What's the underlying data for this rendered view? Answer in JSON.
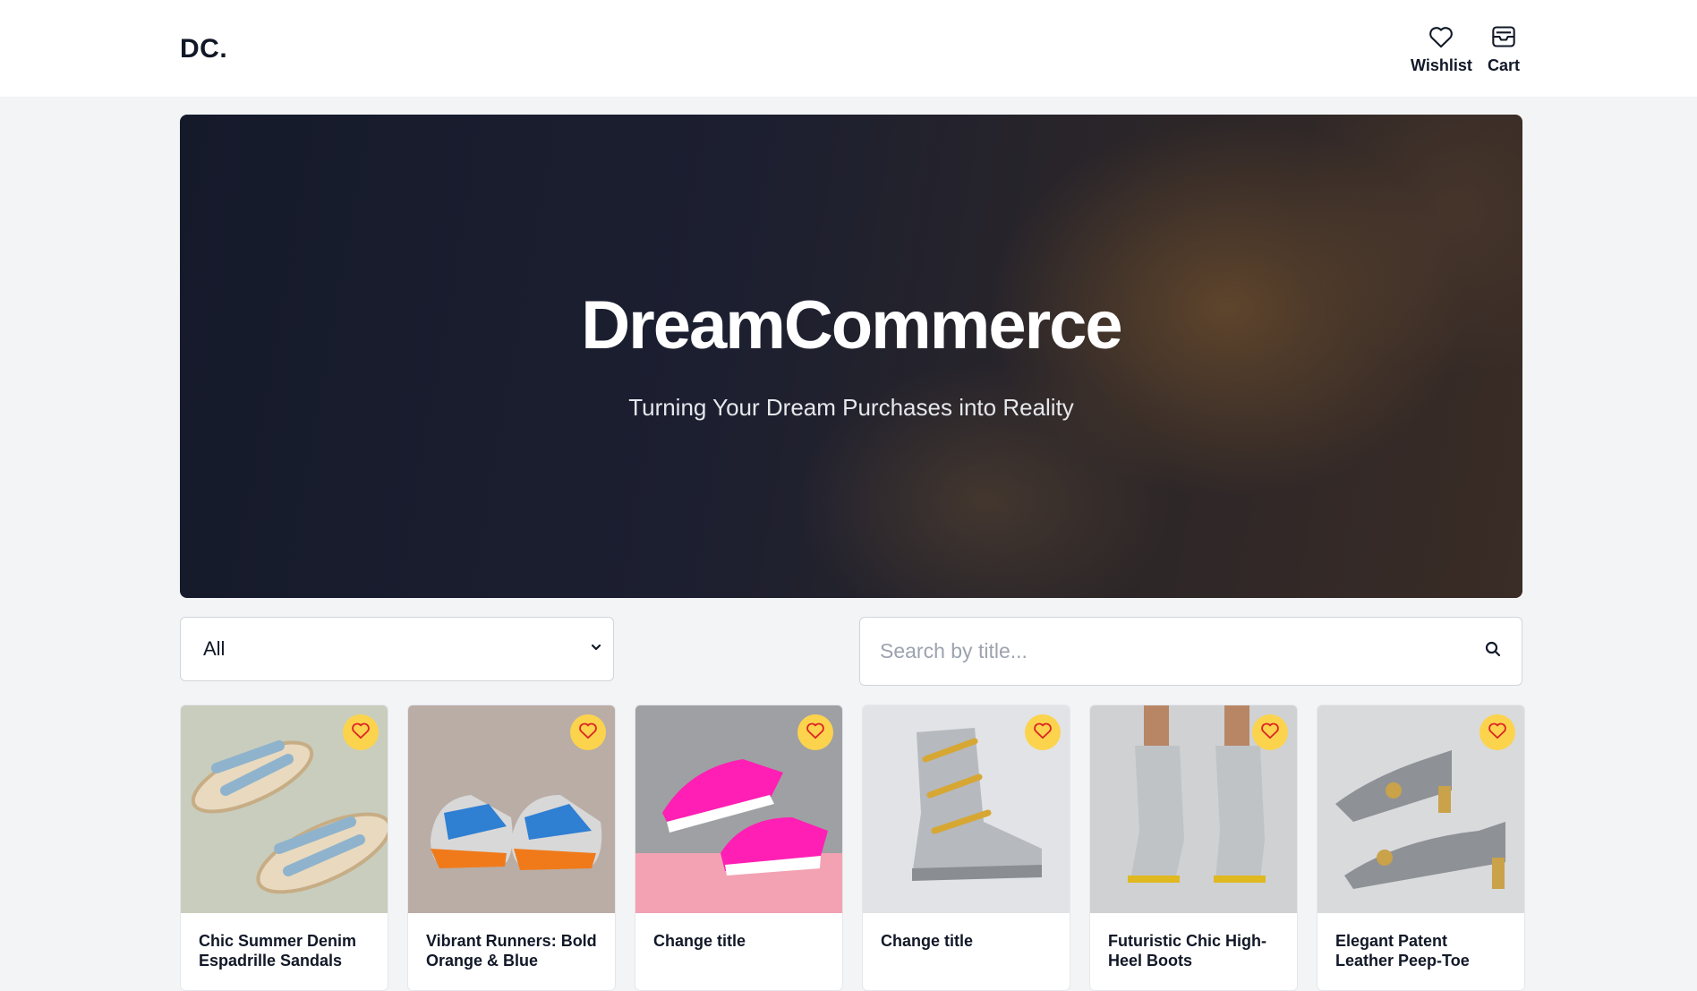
{
  "header": {
    "logo": "DC.",
    "wishlist_label": "Wishlist",
    "cart_label": "Cart"
  },
  "hero": {
    "title": "DreamCommerce",
    "subtitle": "Turning Your Dream Purchases into Reality"
  },
  "filters": {
    "category_value": "All",
    "search_placeholder": "Search by title..."
  },
  "colors": {
    "accent": "#fcd34d",
    "text": "#111827",
    "background": "#f3f4f6"
  },
  "products": [
    {
      "title": "Chic Summer Denim Espadrille Sandals",
      "icon": "heart-icon"
    },
    {
      "title": "Vibrant Runners: Bold Orange & Blue",
      "icon": "heart-icon"
    },
    {
      "title": "Change title",
      "icon": "heart-icon"
    },
    {
      "title": "Change title",
      "icon": "heart-icon"
    },
    {
      "title": "Futuristic Chic High-Heel Boots",
      "icon": "heart-icon"
    },
    {
      "title": "Elegant Patent Leather Peep-Toe",
      "icon": "heart-icon"
    }
  ]
}
